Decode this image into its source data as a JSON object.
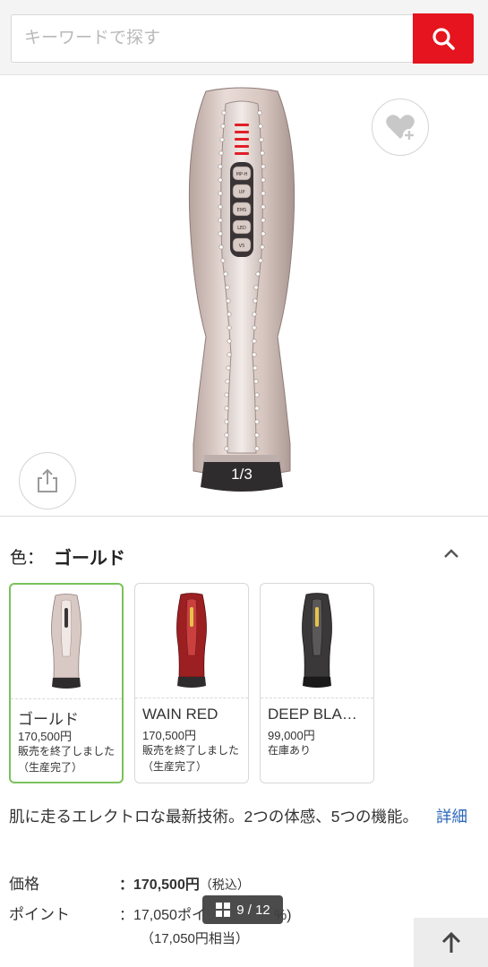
{
  "search": {
    "placeholder": "キーワードで探す"
  },
  "hero": {
    "image_counter": "1/3"
  },
  "device_buttons": [
    "MP-H",
    "UP",
    "EMS",
    "LED",
    "V5"
  ],
  "color": {
    "label": "色：",
    "selected": "ゴールド",
    "options": [
      {
        "name": "ゴールド",
        "price": "170,500円",
        "status": "販売を終了しました（生産完了）",
        "body_color": "#d9c9c4"
      },
      {
        "name": "WAIN RED",
        "price": "170,500円",
        "status": "販売を終了しました（生産完了）",
        "body_color": "#9c1f22"
      },
      {
        "name": "DEEP BLA…",
        "price": "99,000円",
        "status": "在庫あり",
        "body_color": "#3a3838"
      }
    ]
  },
  "description": {
    "text": "肌に走るエレクトロな最新技術。2つの体感、5つの機能。",
    "more_link": "詳細"
  },
  "pricing": {
    "price_label": "価格",
    "price_value": "：170,500円",
    "price_tax": "（税込）",
    "points_label": "ポイント",
    "points_value": "：17,050ポイ",
    "points_rate": "%)",
    "points_equiv": "（17,050円相当）"
  },
  "page_badge": {
    "text": "9 / 12"
  },
  "colors": {
    "accent_red": "#e5141e",
    "selected_border": "#7ac25b",
    "link_blue": "#2a66b8"
  }
}
